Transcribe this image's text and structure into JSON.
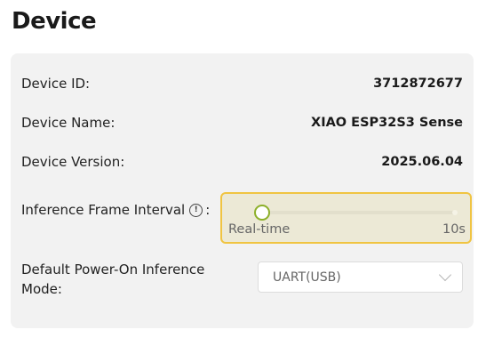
{
  "page": {
    "title": "Device"
  },
  "device": {
    "id_label": "Device ID:",
    "id_value": "3712872677",
    "name_label": "Device Name:",
    "name_value": "XIAO ESP32S3 Sense",
    "version_label": "Device Version:",
    "version_value": "2025.06.04"
  },
  "inference_interval": {
    "label": "Inference Frame Interval",
    "info_icon": "info-icon",
    "info_glyph": "!",
    "colon": ":",
    "min_label": "Real-time",
    "max_label": "10s",
    "value_fraction": 0.0
  },
  "power_on_mode": {
    "label": "Default Power-On Inference Mode:",
    "selected": "UART(USB)"
  },
  "colors": {
    "slider_highlight_border": "#f0c442",
    "slider_handle": "#8db02a",
    "panel_background": "#f2f2f2"
  }
}
